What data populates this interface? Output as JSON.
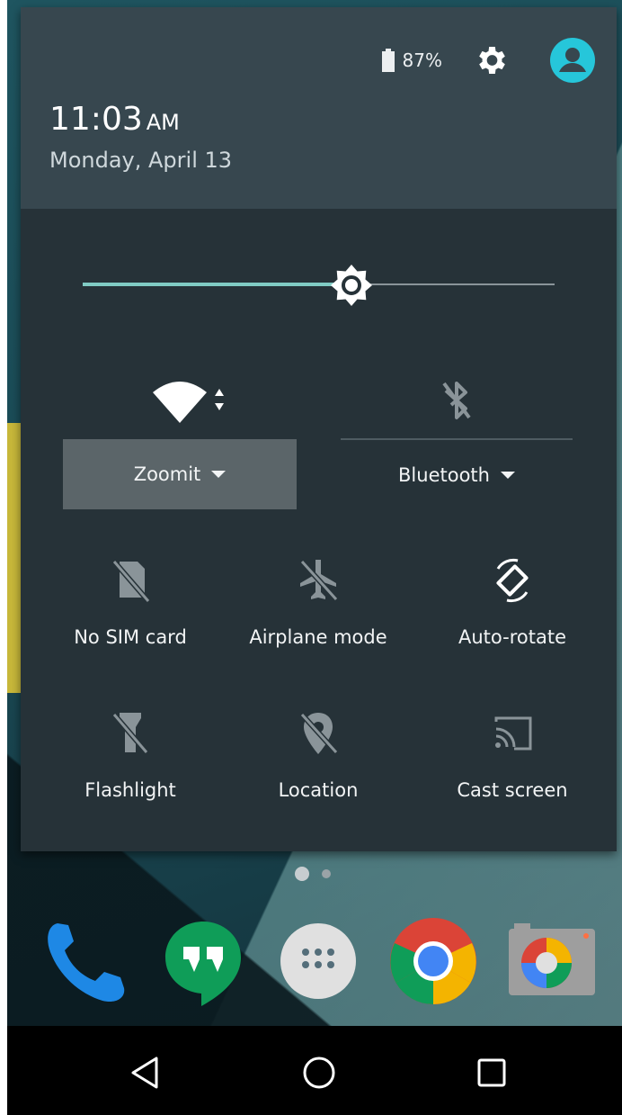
{
  "status": {
    "battery_text": "87%",
    "battery_level": 0.87
  },
  "header": {
    "time": "11:03",
    "ampm": "AM",
    "date": "Monday, April 13"
  },
  "brightness": {
    "level": 0.57
  },
  "wifi": {
    "label": "Zoomit"
  },
  "bluetooth": {
    "label": "Bluetooth"
  },
  "tiles": [
    {
      "label": "No SIM card",
      "icon": "no-sim-icon"
    },
    {
      "label": "Airplane mode",
      "icon": "airplane-off-icon"
    },
    {
      "label": "Auto-rotate",
      "icon": "auto-rotate-icon"
    },
    {
      "label": "Flashlight",
      "icon": "flashlight-off-icon"
    },
    {
      "label": "Location",
      "icon": "location-off-icon"
    },
    {
      "label": "Cast screen",
      "icon": "cast-icon"
    }
  ],
  "dock": [
    "phone-icon",
    "hangouts-icon",
    "app-drawer-icon",
    "chrome-icon",
    "camera-icon"
  ],
  "colors": {
    "accent": "#80cbc4",
    "avatar": "#26c6da",
    "shade": "#263238",
    "header": "#37474f"
  }
}
